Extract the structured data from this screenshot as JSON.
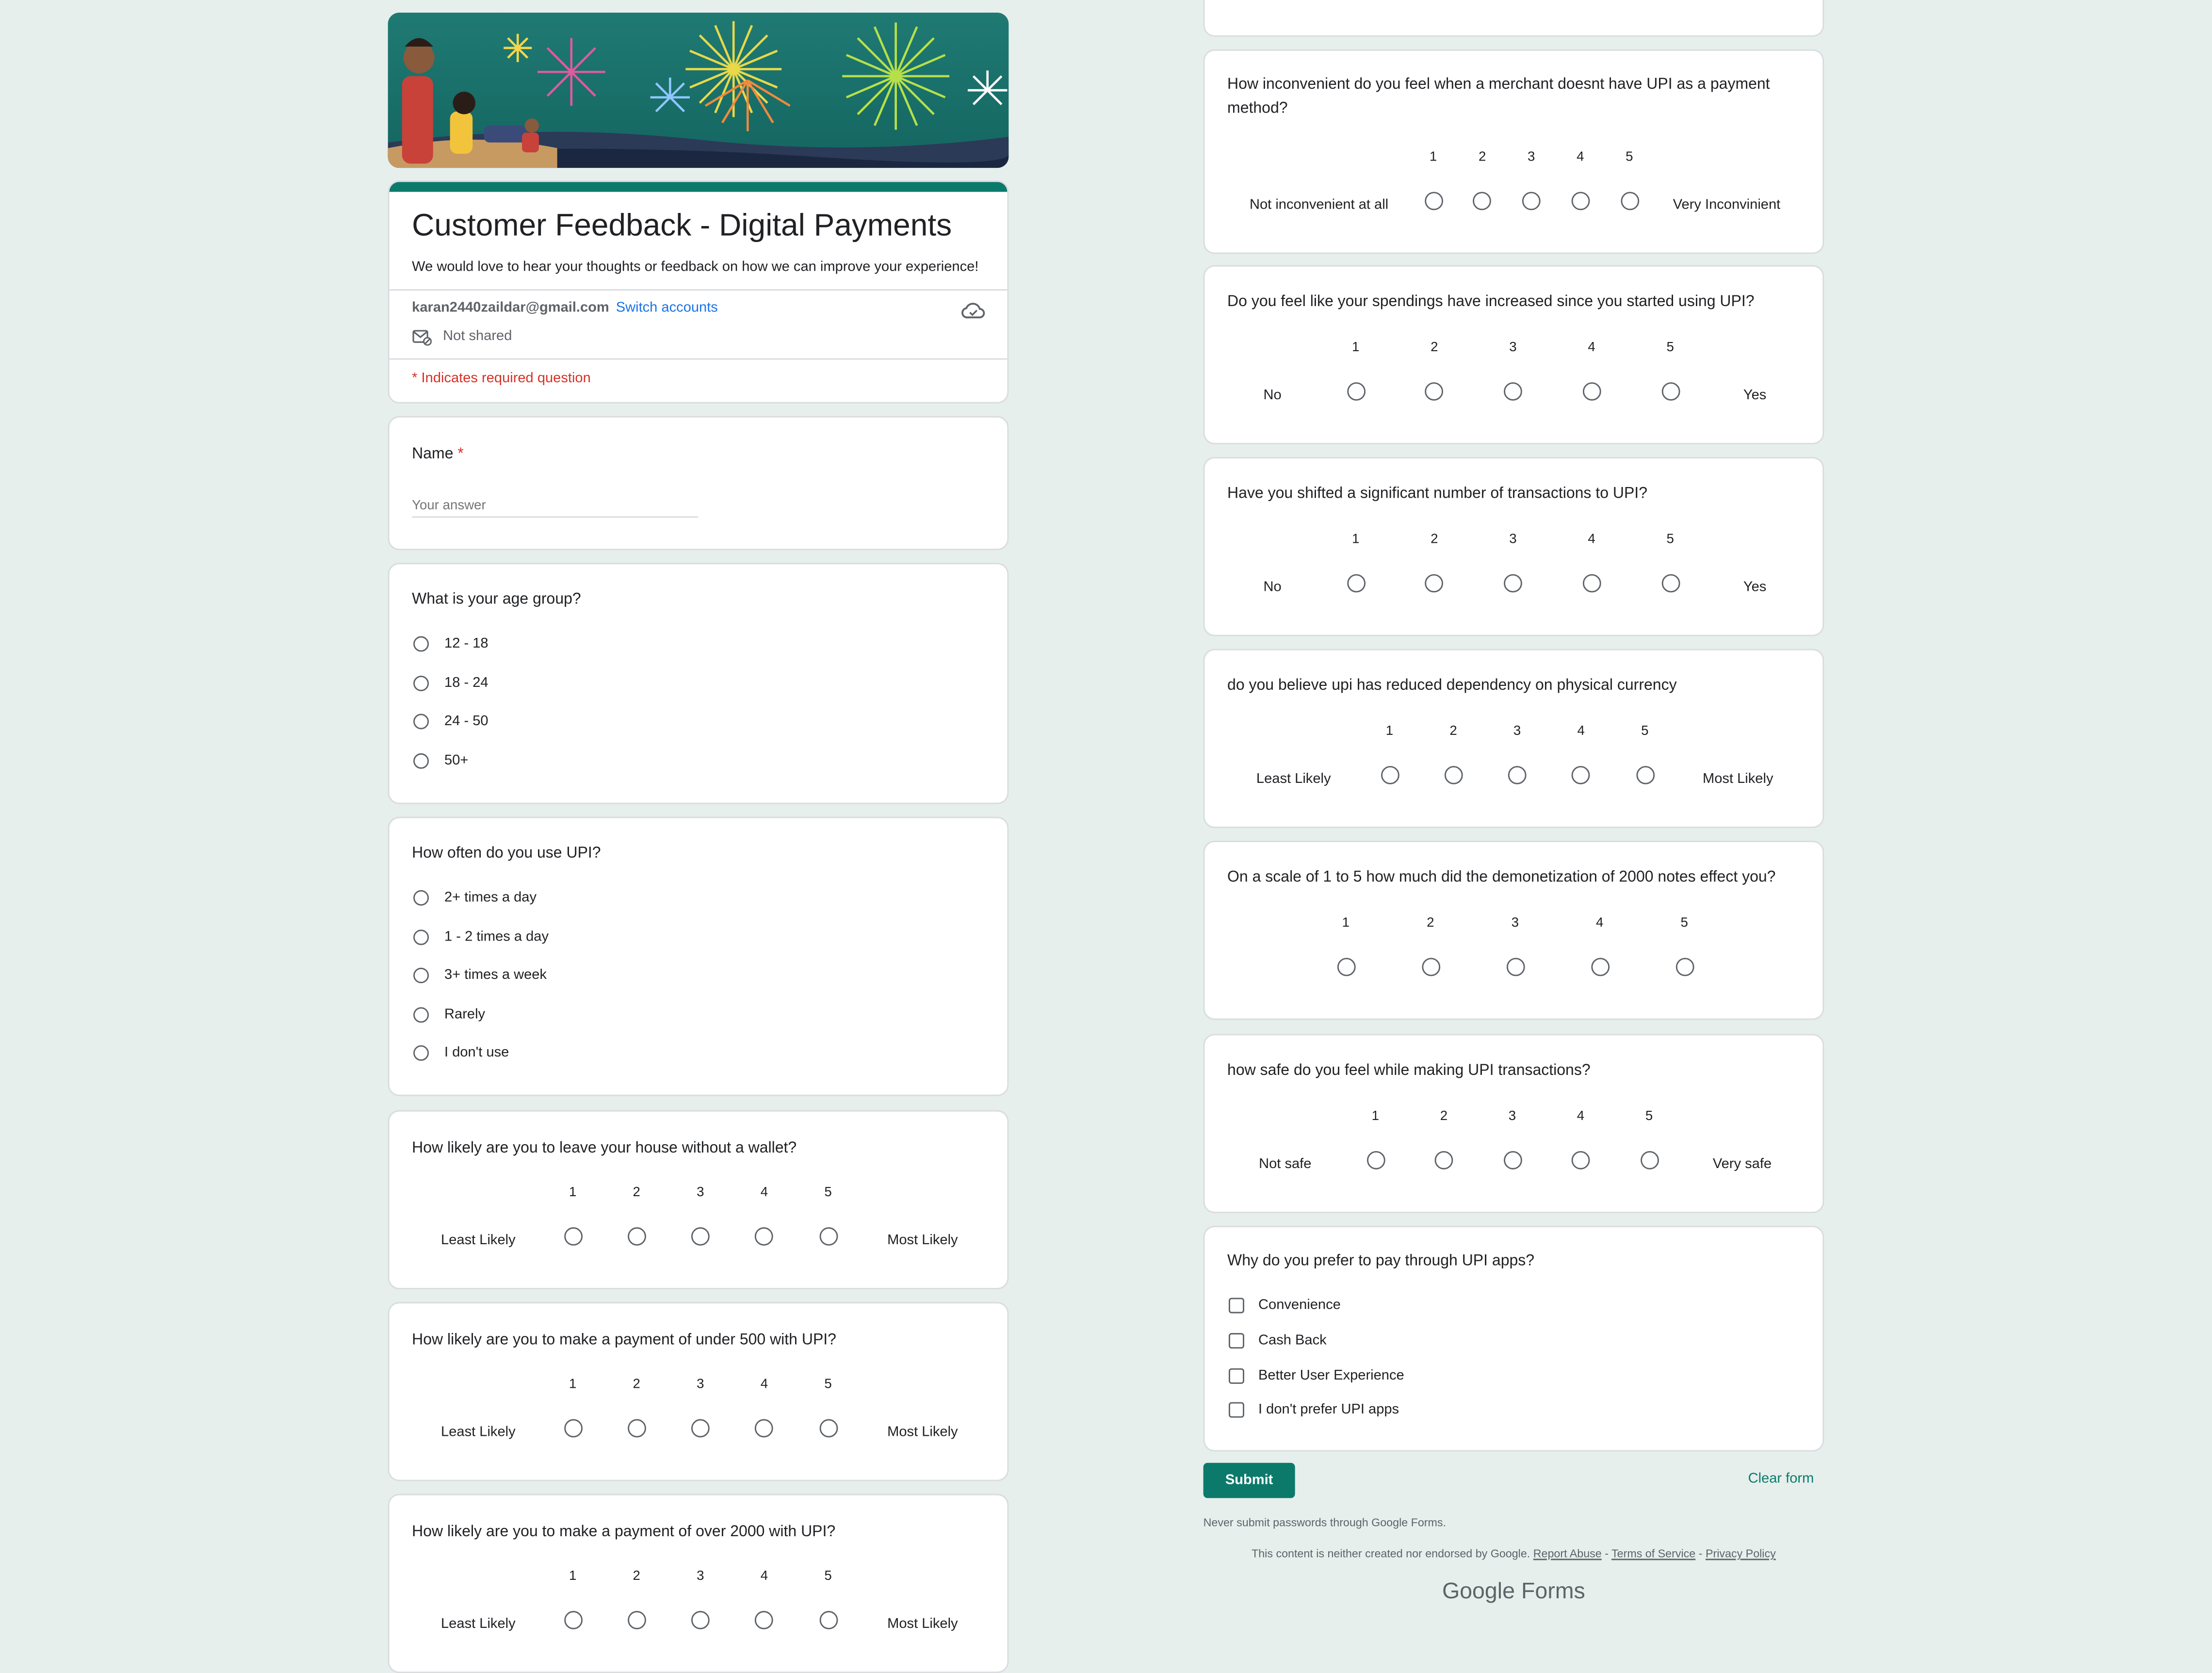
{
  "form": {
    "title": "Customer Feedback - Digital Payments",
    "description": "We would love to hear your thoughts or feedback on how we can improve your experience!",
    "account_email": "karan2440zaildar@gmail.com",
    "switch_accounts": "Switch accounts",
    "not_shared": "Not shared",
    "required_note": "* Indicates required question",
    "accent_color": "#0b7a6b"
  },
  "name_question": {
    "label": "Name",
    "required_mark": "*",
    "placeholder": "Your answer"
  },
  "age_question": {
    "label": "What is your age group?",
    "options": [
      "12 - 18",
      "18 - 24",
      "24 - 50",
      "50+"
    ]
  },
  "frequency_question": {
    "label": "How often do you use UPI?",
    "options": [
      "2+ times a day",
      "1 - 2 times a day",
      "3+ times a week",
      "Rarely",
      "I don't use"
    ]
  },
  "scale_numbers": [
    "1",
    "2",
    "3",
    "4",
    "5"
  ],
  "scales": [
    {
      "label": "How likely are you to leave your house without a wallet?",
      "low": "Least Likely",
      "high": "Most Likely"
    },
    {
      "label": "How likely are you to make a payment of under 500 with UPI?",
      "low": "Least Likely",
      "high": "Most Likely"
    },
    {
      "label": "How likely are you to make a payment of over 2000 with UPI?",
      "low": "Least Likely",
      "high": "Most Likely"
    },
    {
      "label": "How inconvenient do you feel when a merchant doesnt have UPI as a payment method?",
      "low": "Not inconvenient at all",
      "high": "Very Inconvinient"
    },
    {
      "label": "Do you feel like your spendings have increased since you started using UPI?",
      "low": "No",
      "high": "Yes"
    },
    {
      "label": "Have you shifted a significant number of transactions to UPI?",
      "low": "No",
      "high": "Yes"
    },
    {
      "label": "do you believe upi has reduced dependency on physical currency",
      "low": "Least Likely",
      "high": "Most Likely"
    },
    {
      "label": "On a scale of 1 to 5 how much did the demonetization of 2000 notes effect you?",
      "low": "",
      "high": ""
    },
    {
      "label": "how safe do you feel while making UPI transactions?",
      "low": "Not safe",
      "high": "Very safe"
    }
  ],
  "prefer_question": {
    "label": "Why do you prefer to pay through UPI apps?",
    "options": [
      "Convenience",
      "Cash Back",
      "Better User Experience",
      "I don't prefer UPI apps"
    ]
  },
  "actions": {
    "submit": "Submit",
    "clear": "Clear form"
  },
  "footer": {
    "warning": "Never submit passwords through Google Forms.",
    "disclaimer": "This content is neither created nor endorsed by Google.",
    "report": "Report Abuse",
    "sep1": " - ",
    "terms": "Terms of Service",
    "sep2": " - ",
    "privacy": "Privacy Policy",
    "logo_google": "Google",
    "logo_forms": "Forms"
  }
}
